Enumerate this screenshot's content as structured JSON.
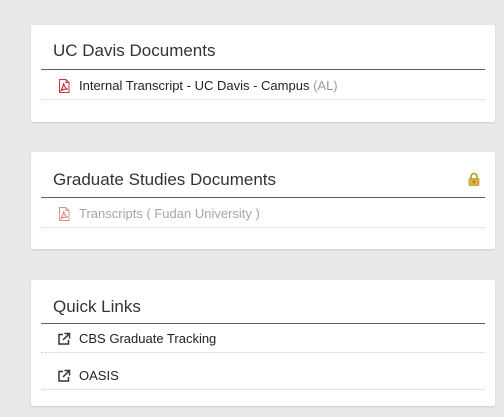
{
  "cards": {
    "uc_davis": {
      "title": "UC Davis Documents",
      "items": [
        {
          "label": "Internal Transcript - UC Davis - Campus",
          "note": "(AL)",
          "icon": "pdf-icon"
        }
      ]
    },
    "graduate_studies": {
      "title": "Graduate Studies Documents",
      "lock_icon": "lock-icon",
      "items": [
        {
          "label": "Transcripts ( Fudan University )",
          "icon": "pdf-icon",
          "disabled": true
        }
      ]
    },
    "quick_links": {
      "title": "Quick Links",
      "items": [
        {
          "label": "CBS Graduate Tracking",
          "icon": "external-link-icon"
        },
        {
          "label": "OASIS",
          "icon": "external-link-icon"
        }
      ]
    }
  },
  "colors": {
    "background": "#e8e9ea",
    "card": "#ffffff",
    "pdf_red": "#d2232a",
    "lock_gold": "#c8a43a"
  }
}
